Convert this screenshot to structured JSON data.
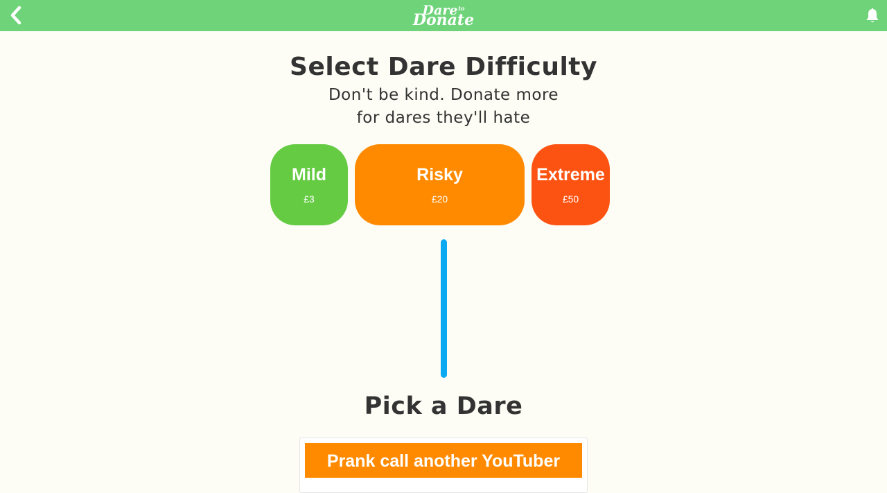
{
  "header": {
    "logo_top": "Dare",
    "logo_small": "to",
    "logo_bottom": "Donate",
    "background_color": "#6fd37a",
    "back_icon": "chevron-left-icon",
    "notification_icon": "bell-icon"
  },
  "main": {
    "title": "Select Dare Difficulty",
    "subtitle_line1": "Don't be kind. Donate more",
    "subtitle_line2": "for dares they'll hate"
  },
  "difficulties": [
    {
      "name": "Mild",
      "price": "£3",
      "color": "#65cb43"
    },
    {
      "name": "Risky",
      "price": "£20",
      "color": "#ff8a00"
    },
    {
      "name": "Extreme",
      "price": "£50",
      "color": "#fd5312"
    }
  ],
  "progress": {
    "fill_fraction": 1.0,
    "color": "#0aa9f2"
  },
  "pick": {
    "title": "Pick a Dare",
    "options": [
      {
        "label": "Prank call another YouTuber",
        "color": "#ff8a00"
      }
    ]
  }
}
